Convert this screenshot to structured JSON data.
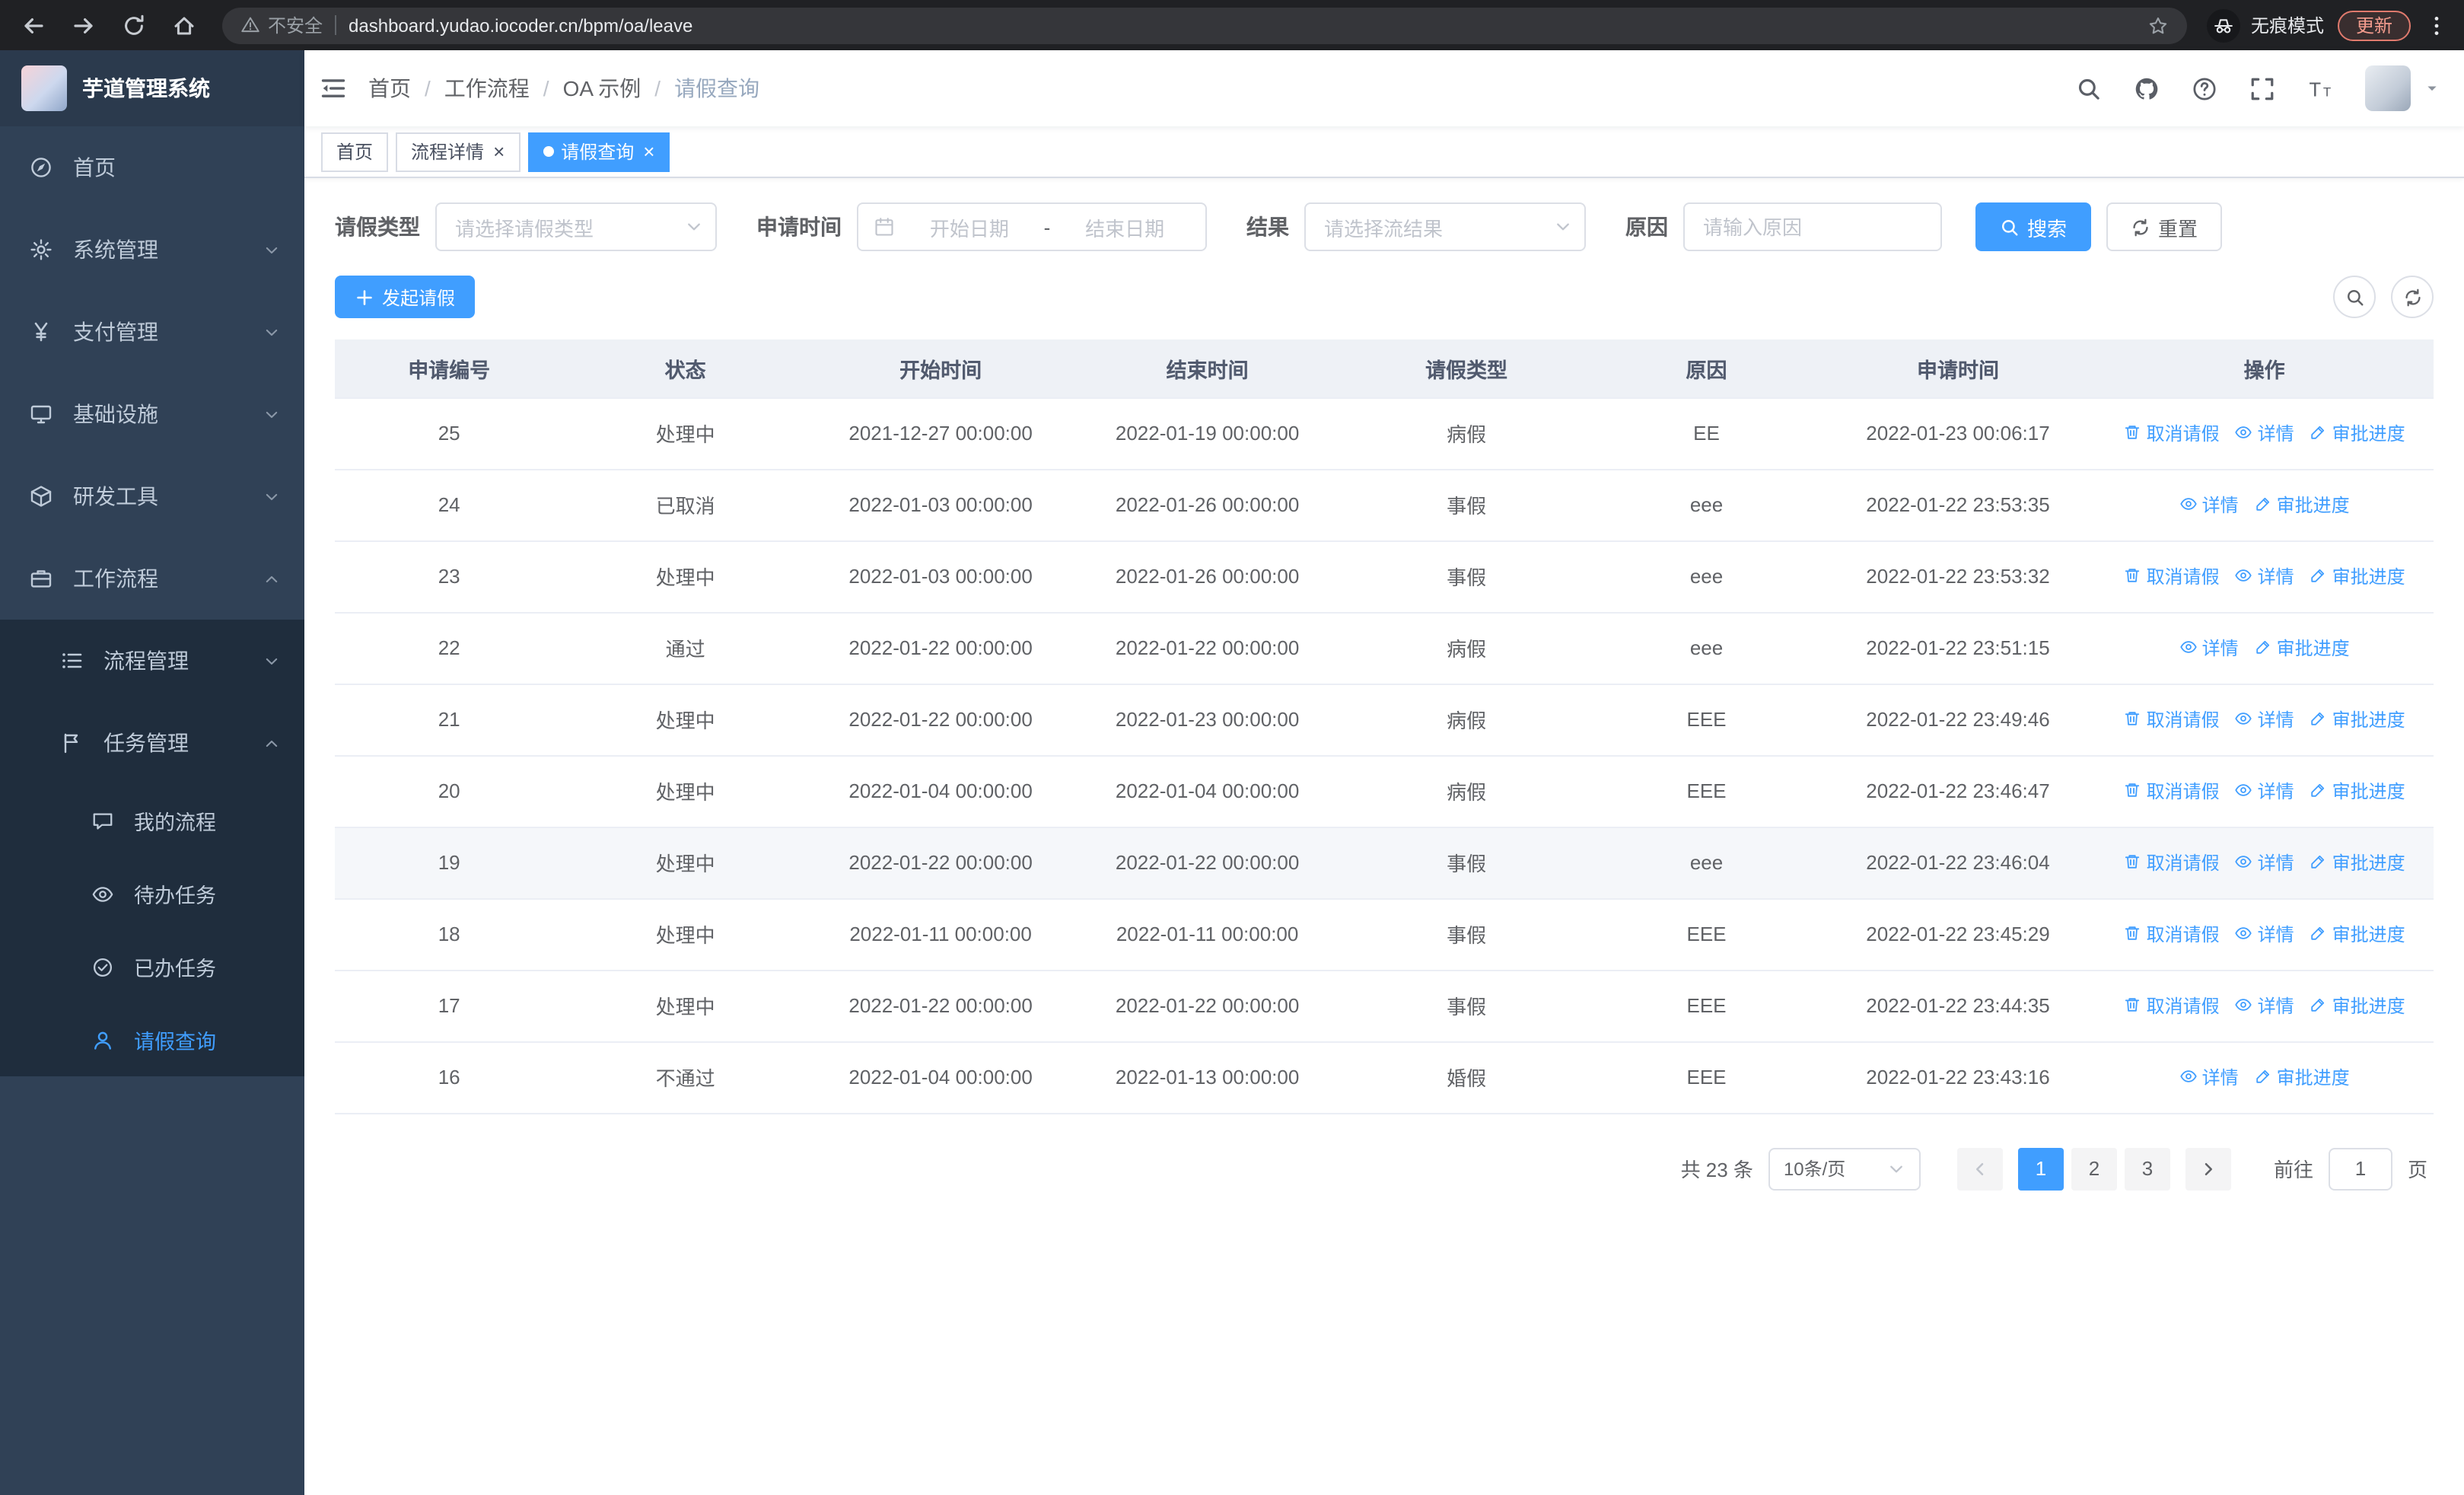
{
  "browser": {
    "security_label": "不安全",
    "url": "dashboard.yudao.iocoder.cn/bpm/oa/leave",
    "incognito_label": "无痕模式",
    "update_label": "更新"
  },
  "app": {
    "title": "芋道管理系统"
  },
  "sidebar": {
    "items": [
      {
        "key": "home",
        "label": "首页",
        "icon": "compass",
        "level": 1
      },
      {
        "key": "system-mgmt",
        "label": "系统管理",
        "icon": "gear",
        "level": 1,
        "expandable": true,
        "expanded": false
      },
      {
        "key": "payment-mgmt",
        "label": "支付管理",
        "icon": "yen",
        "level": 1,
        "expandable": true,
        "expanded": false
      },
      {
        "key": "infrastructure",
        "label": "基础设施",
        "icon": "monitor",
        "level": 1,
        "expandable": true,
        "expanded": false
      },
      {
        "key": "dev-tools",
        "label": "研发工具",
        "icon": "cube",
        "level": 1,
        "expandable": true,
        "expanded": false
      },
      {
        "key": "workflow",
        "label": "工作流程",
        "icon": "briefcase",
        "level": 1,
        "expandable": true,
        "expanded": true
      },
      {
        "key": "process-mgmt",
        "label": "流程管理",
        "icon": "list",
        "level": 2,
        "expandable": true,
        "expanded": false
      },
      {
        "key": "task-mgmt",
        "label": "任务管理",
        "icon": "flag",
        "level": 2,
        "expandable": true,
        "expanded": true
      },
      {
        "key": "my-process",
        "label": "我的流程",
        "icon": "chat",
        "level": 3
      },
      {
        "key": "todo-task",
        "label": "待办任务",
        "icon": "eye",
        "level": 3
      },
      {
        "key": "done-task",
        "label": "已办任务",
        "icon": "check-circle",
        "level": 3
      },
      {
        "key": "leave-query",
        "label": "请假查询",
        "icon": "user",
        "level": 3,
        "active": true
      }
    ]
  },
  "header": {
    "breadcrumb": [
      "首页",
      "工作流程",
      "OA 示例",
      "请假查询"
    ]
  },
  "tabs": [
    {
      "key": "home",
      "label": "首页",
      "closable": false,
      "active": false
    },
    {
      "key": "process-detail",
      "label": "流程详情",
      "closable": true,
      "active": false
    },
    {
      "key": "leave-query",
      "label": "请假查询",
      "closable": true,
      "active": true
    }
  ],
  "filters": {
    "leave_type_label": "请假类型",
    "leave_type_placeholder": "请选择请假类型",
    "apply_time_label": "申请时间",
    "start_placeholder": "开始日期",
    "range_separator": "-",
    "end_placeholder": "结束日期",
    "result_label": "结果",
    "result_placeholder": "请选择流结果",
    "reason_label": "原因",
    "reason_placeholder": "请输入原因",
    "search_label": "搜索",
    "reset_label": "重置"
  },
  "toolbar": {
    "create_label": "发起请假"
  },
  "table": {
    "columns": [
      "申请编号",
      "状态",
      "开始时间",
      "结束时间",
      "请假类型",
      "原因",
      "申请时间",
      "操作"
    ],
    "action_labels": {
      "cancel": "取消请假",
      "detail": "详情",
      "progress": "审批进度"
    },
    "rows": [
      {
        "id": "25",
        "status": "处理中",
        "start": "2021-12-27 00:00:00",
        "end": "2022-01-19 00:00:00",
        "type": "病假",
        "reason": "EE",
        "applied": "2022-01-23 00:06:17",
        "actions": [
          "cancel",
          "detail",
          "progress"
        ]
      },
      {
        "id": "24",
        "status": "已取消",
        "start": "2022-01-03 00:00:00",
        "end": "2022-01-26 00:00:00",
        "type": "事假",
        "reason": "eee",
        "applied": "2022-01-22 23:53:35",
        "actions": [
          "detail",
          "progress"
        ]
      },
      {
        "id": "23",
        "status": "处理中",
        "start": "2022-01-03 00:00:00",
        "end": "2022-01-26 00:00:00",
        "type": "事假",
        "reason": "eee",
        "applied": "2022-01-22 23:53:32",
        "actions": [
          "cancel",
          "detail",
          "progress"
        ]
      },
      {
        "id": "22",
        "status": "通过",
        "start": "2022-01-22 00:00:00",
        "end": "2022-01-22 00:00:00",
        "type": "病假",
        "reason": "eee",
        "applied": "2022-01-22 23:51:15",
        "actions": [
          "detail",
          "progress"
        ]
      },
      {
        "id": "21",
        "status": "处理中",
        "start": "2022-01-22 00:00:00",
        "end": "2022-01-23 00:00:00",
        "type": "病假",
        "reason": "EEE",
        "applied": "2022-01-22 23:49:46",
        "actions": [
          "cancel",
          "detail",
          "progress"
        ]
      },
      {
        "id": "20",
        "status": "处理中",
        "start": "2022-01-04 00:00:00",
        "end": "2022-01-04 00:00:00",
        "type": "病假",
        "reason": "EEE",
        "applied": "2022-01-22 23:46:47",
        "actions": [
          "cancel",
          "detail",
          "progress"
        ]
      },
      {
        "id": "19",
        "status": "处理中",
        "start": "2022-01-22 00:00:00",
        "end": "2022-01-22 00:00:00",
        "type": "事假",
        "reason": "eee",
        "applied": "2022-01-22 23:46:04",
        "actions": [
          "cancel",
          "detail",
          "progress"
        ],
        "highlighted": true
      },
      {
        "id": "18",
        "status": "处理中",
        "start": "2022-01-11 00:00:00",
        "end": "2022-01-11 00:00:00",
        "type": "事假",
        "reason": "EEE",
        "applied": "2022-01-22 23:45:29",
        "actions": [
          "cancel",
          "detail",
          "progress"
        ]
      },
      {
        "id": "17",
        "status": "处理中",
        "start": "2022-01-22 00:00:00",
        "end": "2022-01-22 00:00:00",
        "type": "事假",
        "reason": "EEE",
        "applied": "2022-01-22 23:44:35",
        "actions": [
          "cancel",
          "detail",
          "progress"
        ]
      },
      {
        "id": "16",
        "status": "不通过",
        "start": "2022-01-04 00:00:00",
        "end": "2022-01-13 00:00:00",
        "type": "婚假",
        "reason": "EEE",
        "applied": "2022-01-22 23:43:16",
        "actions": [
          "detail",
          "progress"
        ]
      }
    ]
  },
  "pagination": {
    "total_label": "共 23 条",
    "page_size_value": "10条/页",
    "pages": [
      "1",
      "2",
      "3"
    ],
    "active_page": "1",
    "goto_label": "前往",
    "goto_value": "1",
    "goto_suffix": "页"
  },
  "colors": {
    "accent": "#409eff",
    "sidebar_bg": "#304156",
    "submenu_bg": "#1f2d3d",
    "chrome_bg": "#202124"
  }
}
